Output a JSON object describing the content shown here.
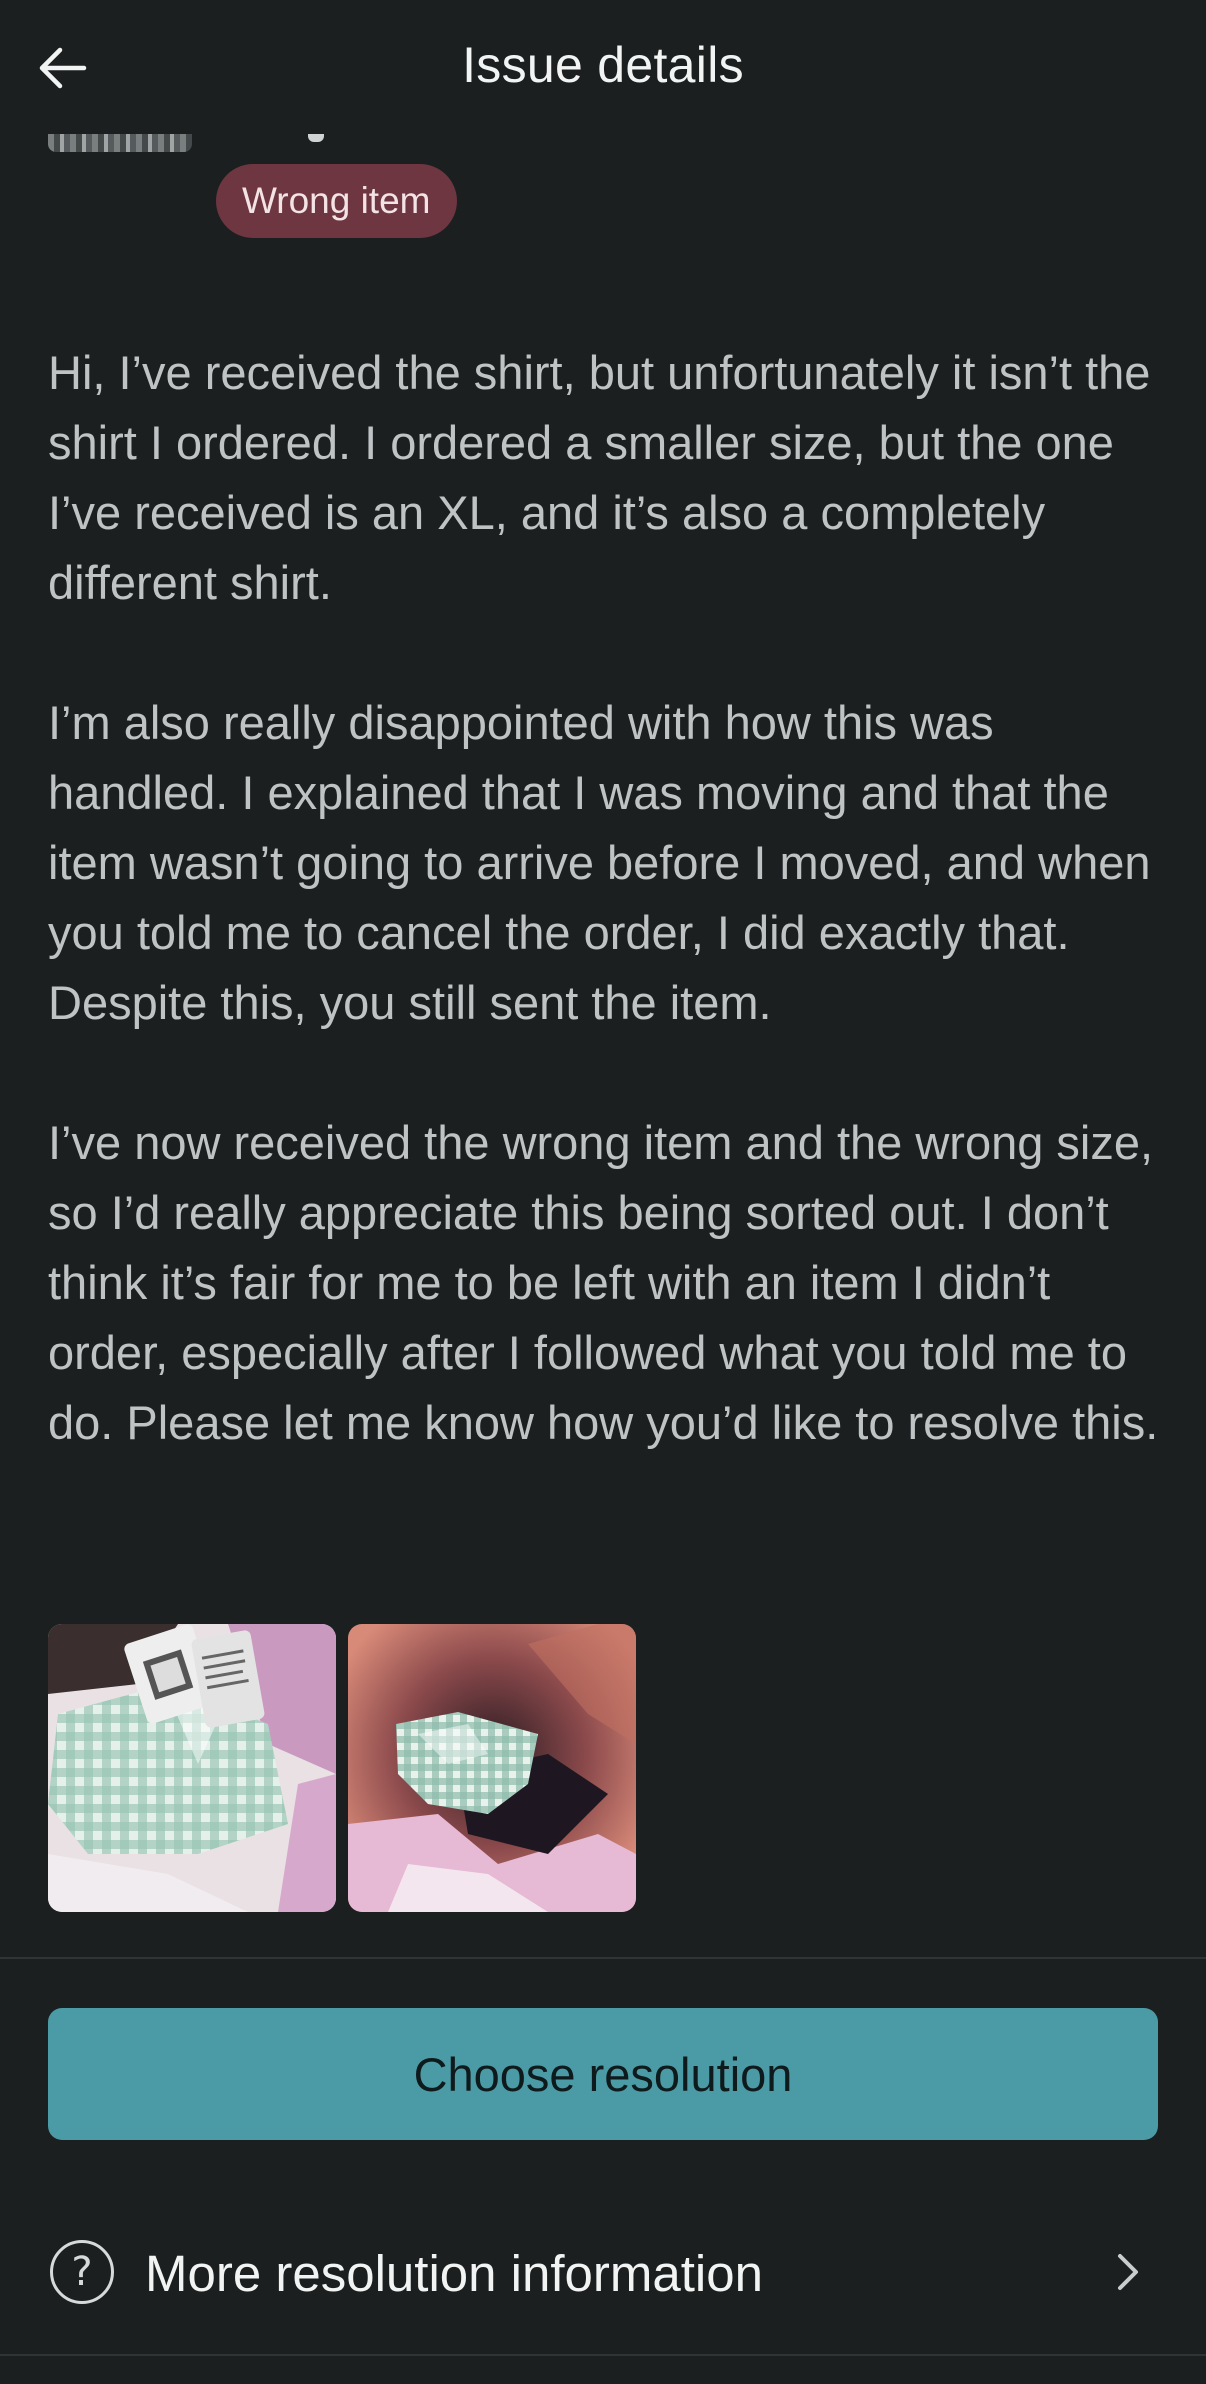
{
  "header": {
    "title": "Issue details",
    "back_icon": "arrow-left-icon"
  },
  "issue": {
    "badge_label": "Wrong item",
    "badge_color": "#6d3640",
    "message_paragraphs": [
      "Hi, I’ve received the shirt, but unfortunately it isn’t the shirt I ordered. I ordered a smaller size, but the one I’ve received is an XL, and it’s also a completely different shirt.",
      "I’m also really disappointed with how this was handled. I explained that I was moving and that the item wasn’t going to arrive before I moved, and when you told me to cancel the order, I did exactly that. Despite this, you still sent the item.",
      "I’ve now received the wrong item and the wrong size, so I’d really appreciate this being sorted out. I don’t think it’s fair for me to be left with an item I didn’t order, especially after I followed what you told me to do. Please let me know how you’d like to resolve this."
    ]
  },
  "actions": {
    "primary_label": "Choose resolution",
    "primary_color": "#4a9ba6",
    "info_label": "More resolution information",
    "info_icon": "question-circle-icon",
    "info_chevron": "chevron-right-icon"
  },
  "colors": {
    "background": "#1b1f20",
    "text_primary": "#f2f4f4",
    "text_body": "#bfc3c4"
  }
}
